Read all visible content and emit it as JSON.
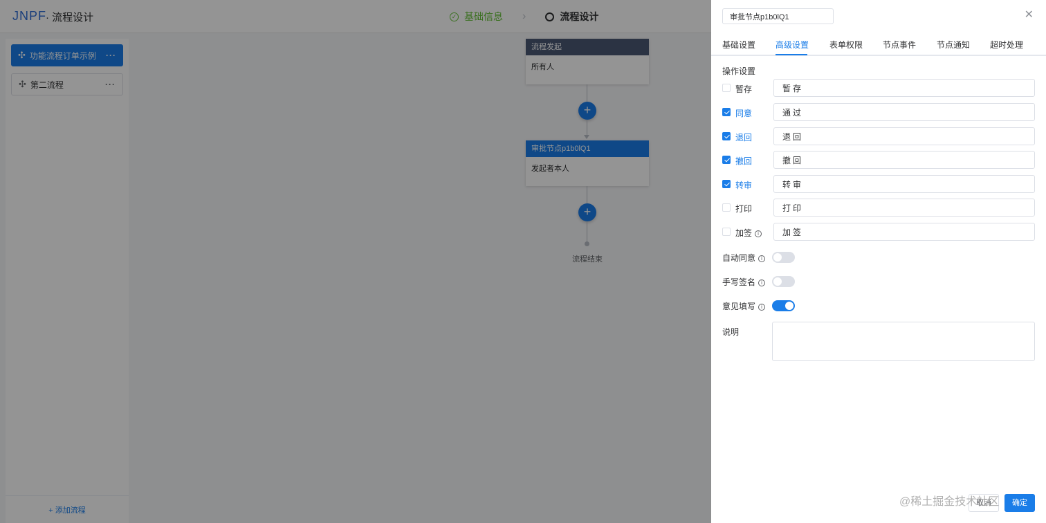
{
  "app": {
    "logo": "JNPF",
    "title": "· 流程设计",
    "steps": [
      {
        "label": "基础信息",
        "status": "done"
      },
      {
        "label": "流程设计",
        "status": "current"
      }
    ]
  },
  "sidebar": {
    "flows": [
      {
        "label": "功能流程订单示例",
        "active": true
      },
      {
        "label": "第二流程",
        "active": false
      }
    ],
    "more_glyph": "···",
    "add_label": "+ 添加流程"
  },
  "canvas": {
    "start_node": {
      "title": "流程发起",
      "body": "所有人"
    },
    "approve_node": {
      "title": "审批节点p1b0lQ1",
      "body": "发起者本人"
    },
    "add_glyph": "+",
    "end_label": "流程结束"
  },
  "drawer": {
    "node_name_value": "审批节点p1b0lQ1",
    "close_glyph": "✕",
    "tabs": [
      "基础设置",
      "高级设置",
      "表单权限",
      "节点事件",
      "节点通知",
      "超时处理"
    ],
    "active_tab": "高级设置",
    "section_title": "操作设置",
    "operations": [
      {
        "label": "暂存",
        "checked": false,
        "value": "暂存",
        "has_info": false
      },
      {
        "label": "同意",
        "checked": true,
        "value": "通过",
        "has_info": false
      },
      {
        "label": "退回",
        "checked": true,
        "value": "退回",
        "has_info": false
      },
      {
        "label": "撤回",
        "checked": true,
        "value": "撤回",
        "has_info": false
      },
      {
        "label": "转审",
        "checked": true,
        "value": "转审",
        "has_info": false
      },
      {
        "label": "打印",
        "checked": false,
        "value": "打印",
        "has_info": false
      },
      {
        "label": "加签",
        "checked": false,
        "value": "加签",
        "has_info": true
      }
    ],
    "switches": [
      {
        "label": "自动同意",
        "on": false
      },
      {
        "label": "手写签名",
        "on": false
      },
      {
        "label": "意见填写",
        "on": true
      }
    ],
    "desc_label": "说明",
    "desc_value": "",
    "info_glyph": "i",
    "cancel_label": "取消",
    "confirm_label": "确定",
    "watermark": "@稀土掘金技术社区"
  },
  "colors": {
    "primary": "#1a7de8",
    "success": "#67c23a",
    "start_node_header": "#4a5874"
  }
}
